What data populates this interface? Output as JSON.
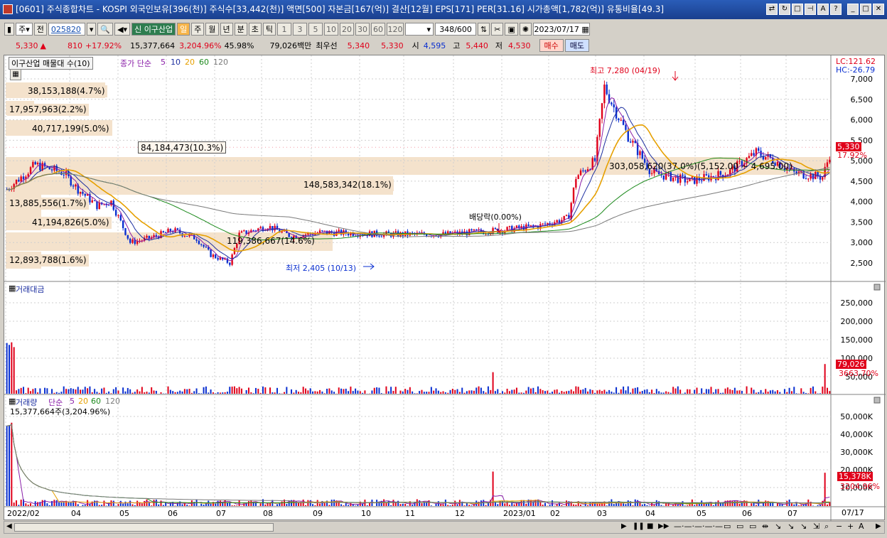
{
  "window": {
    "title": "[0601] 주식종합차트 - KOSPI 외국인보유[396(천)] 주식수[33,442(천)] 액면[500] 자본금[167(억)] 결산[12월] EPS[171] PER[31.16] 시가총액[1,782(억)] 유통비율[49.3]"
  },
  "toolbar": {
    "period_sel": "주",
    "prev": "전",
    "code": "025820",
    "stock_name": "이구산업",
    "sin": "신",
    "timeframes": [
      "일",
      "주",
      "월",
      "년",
      "분",
      "초",
      "틱"
    ],
    "ticks": [
      "1",
      "3",
      "5",
      "10",
      "20",
      "30",
      "60",
      "120"
    ],
    "count": "348",
    "count_max": "/600",
    "date": "2023/07/17"
  },
  "quote": {
    "price": "5,330",
    "change_arrow": "▲",
    "change": "810",
    "change_pct": "+17.92%",
    "volume": "15,377,664",
    "volume_pct": "3,204.96%",
    "ratio": "45.98%",
    "trade_amount": "79,026백만",
    "best_bid_label": "최우선",
    "bid": "5,340",
    "ask": "5,330",
    "open_label": "시",
    "open": "4,595",
    "high_label": "고",
    "high": "5,440",
    "low_label": "저",
    "low": "4,530",
    "buy": "매수",
    "sell": "매도"
  },
  "price_panel": {
    "overlay_label": "이구산업 매물대 수(10)",
    "ma_label": "종가 단순",
    "ma_periods": [
      "5",
      "10",
      "20",
      "60",
      "120"
    ],
    "lc": "LC:121.62",
    "hc": "HC:-26.79",
    "high_note": "최고 7,280 (04/19)",
    "low_note": "최저 2,405 (10/13)",
    "dividend_note": "배당락(0.00%)",
    "current_price": "5,330",
    "current_pct": "17.92%",
    "y_axis": [
      "7,000",
      "6,500",
      "6,000",
      "5,500",
      "5,000",
      "4,500",
      "4,000",
      "3,500",
      "3,000",
      "2,500"
    ],
    "volume_profile": [
      "38,153,188(4.7%)",
      "17,957,963(2.2%)",
      "40,717,199(5.0%)",
      "84,184,473(10.3%)",
      "303,058,620(37.0%)(5,152.00 ~ 4,695.00)",
      "148,583,342(18.1%)",
      "13,885,556(1.7%)",
      "41,194,826(5.0%)",
      "119,386,667(14.6%)",
      "12,893,788(1.6%)"
    ]
  },
  "amount_panel": {
    "label": "거래대금",
    "y_axis": [
      "250,000",
      "200,000",
      "150,000",
      "100,000",
      "50,000"
    ],
    "current": "79,026",
    "current_pct": "3663.70%"
  },
  "volume_panel": {
    "label": "거래량",
    "ma_label": "단순",
    "ma_periods": [
      "5",
      "20",
      "60",
      "120"
    ],
    "sub": "15,377,664주(3,204.96%)",
    "y_axis": [
      "50,000K",
      "40,000K",
      "30,000K",
      "20,000K",
      "10,000K"
    ],
    "current": "15,378K",
    "current_pct": "3204.96%"
  },
  "x_axis": [
    "2022/02",
    "04",
    "05",
    "06",
    "07",
    "08",
    "09",
    "10",
    "11",
    "12",
    "2023/01",
    "02",
    "03",
    "04",
    "05",
    "06",
    "07"
  ],
  "x_axis_right": "07/17",
  "colors": {
    "up": "#e0001a",
    "down": "#0a2fd0",
    "profile": "#f4e2cc",
    "ma5": "#8a1fa8",
    "ma10": "#1c2fa0",
    "ma20": "#e6a000",
    "ma60": "#1d8a1d",
    "ma120": "#7a7a7a"
  }
}
